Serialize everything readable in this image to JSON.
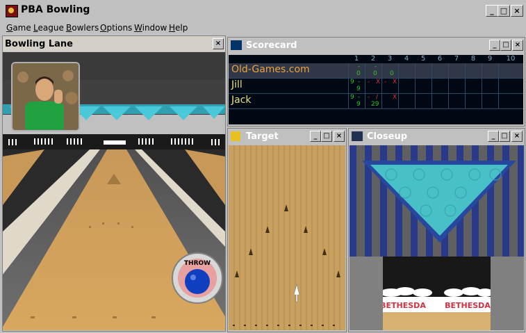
{
  "app": {
    "title": "PBA Bowling"
  },
  "menu": [
    {
      "label": "Game",
      "accel": "G",
      "rest": "ame"
    },
    {
      "label": "League",
      "accel": "L",
      "rest": "eague"
    },
    {
      "label": "Bowlers",
      "accel": "B",
      "rest": "owlers"
    },
    {
      "label": "Options",
      "accel": "O",
      "rest": "ptions"
    },
    {
      "label": "Window",
      "accel": "W",
      "rest": "indow"
    },
    {
      "label": "Help",
      "accel": "H",
      "rest": "elp"
    }
  ],
  "window_buttons": {
    "minimize": "_",
    "maximize": "□",
    "close": "×"
  },
  "lane_panel": {
    "title": "Bowling Lane",
    "throw_label": "THROW"
  },
  "scorecard": {
    "title": "Scorecard",
    "frames": [
      "1",
      "2",
      "3",
      "4",
      "5",
      "6",
      "7",
      "8",
      "9",
      "10"
    ],
    "players": [
      {
        "name": "Old-Games.com",
        "marks": [
          "",
          "-",
          "",
          "-",
          "",
          ""
        ],
        "totals": [
          "0",
          "0",
          "0"
        ]
      },
      {
        "name": "Jill",
        "marks": [
          "9",
          "-",
          "-",
          "X",
          "-",
          "X"
        ],
        "totals": [
          "9",
          "",
          ""
        ]
      },
      {
        "name": "Jack",
        "marks": [
          "9",
          "-",
          "-",
          "/",
          "",
          "X"
        ],
        "totals": [
          "9",
          "29",
          ""
        ]
      }
    ]
  },
  "target_panel": {
    "title": "Target"
  },
  "closeup_panel": {
    "title": "Closeup",
    "sign_left": "BETHESDA",
    "sign_right": "BETHESDA"
  },
  "colors": {
    "scorecard_bg": "#000814",
    "active_name": "#e8a040",
    "player_name": "#e8e080",
    "score_green": "#30c030",
    "mark_red": "#e03030"
  }
}
